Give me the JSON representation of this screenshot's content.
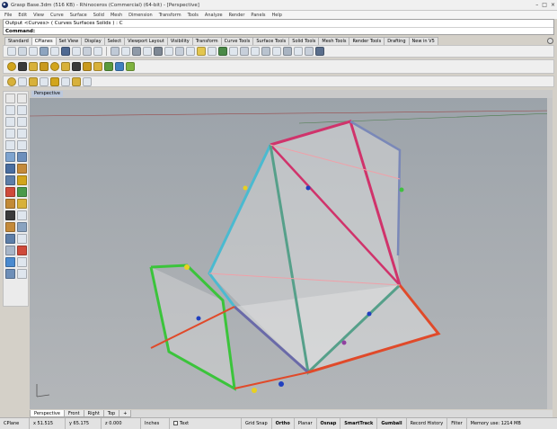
{
  "window": {
    "title": "Grasp Base.3dm (516 KB) - Rhinoceros (Commercial) (64-bit) - [Perspective]",
    "controls": [
      "–",
      "□",
      "×"
    ]
  },
  "menu": [
    "File",
    "Edit",
    "View",
    "Curve",
    "Surface",
    "Solid",
    "Mesh",
    "Dimension",
    "Transform",
    "Tools",
    "Analyze",
    "Render",
    "Panels",
    "Help"
  ],
  "command": {
    "history": "Output <Curves> ( Curves  Surfaces  Solids ) : C",
    "prompt": "Command:"
  },
  "toolbar_tabs": [
    "Standard",
    "CPlanes",
    "Set View",
    "Display",
    "Select",
    "Viewport Layout",
    "Visibility",
    "Transform",
    "Curve Tools",
    "Surface Tools",
    "Solid Tools",
    "Mesh Tools",
    "Render Tools",
    "Drafting",
    "New in V5"
  ],
  "active_toolbar_tab": "CPlanes",
  "viewport": {
    "label": "Perspective"
  },
  "view_tabs": [
    "Perspective",
    "Front",
    "Right",
    "Top",
    "+"
  ],
  "status": {
    "cplane": "CPlane",
    "x": "x 51.515",
    "y": "y 65.175",
    "z": "z 0.000",
    "units": "Inches",
    "layer": "Text",
    "grid_snap": "Grid Snap",
    "ortho": "Ortho",
    "planar": "Planar",
    "osnap": "Osnap",
    "smarttrack": "SmartTrack",
    "gumball": "Gumball",
    "record_history": "Record History",
    "filter": "Filter",
    "memory": "Memory use: 1214 MB"
  }
}
